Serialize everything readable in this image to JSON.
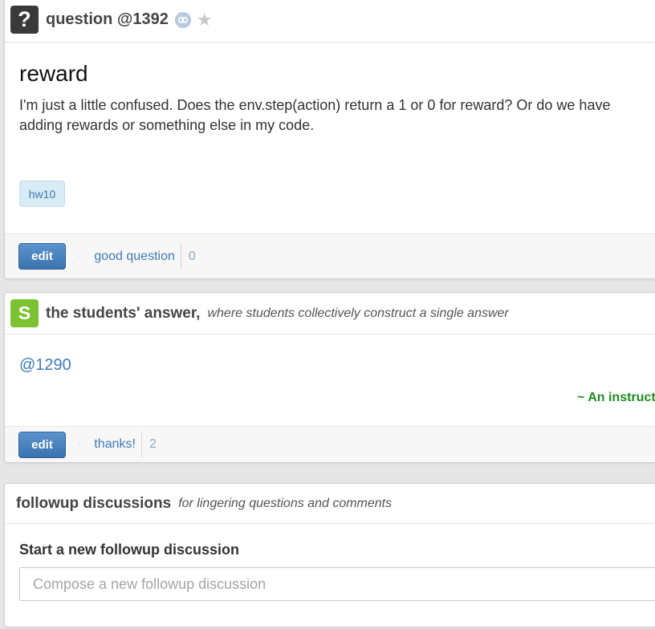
{
  "question": {
    "icon_glyph": "?",
    "header_title": "question @1392",
    "link_icon": "link-icon",
    "star_icon": "star-icon",
    "subject": "reward",
    "body": "I'm just a little confused. Does the env.step(action) return a 1 or 0 for reward? Or do we have\nadding rewards or something else in my code.",
    "tags": [
      "hw10"
    ],
    "footer": {
      "edit_label": "edit",
      "separator": "·",
      "good_question_label": "good question",
      "good_question_count": "0"
    }
  },
  "students_answer": {
    "icon_glyph": "S",
    "title": "the students' answer,",
    "subtitle": "where students collectively construct a single answer",
    "body_ref": "@1290",
    "attribution": "~ An instruct",
    "footer": {
      "edit_label": "edit",
      "separator": "·",
      "thanks_label": "thanks!",
      "thanks_count": "2"
    }
  },
  "followup": {
    "title": "followup discussions",
    "subtitle": "for lingering questions and comments",
    "start_label": "Start a new followup discussion",
    "input_placeholder": "Compose a new followup discussion"
  },
  "colors": {
    "accent_blue": "#3f7ab8",
    "edit_button": "#3a73ae",
    "students_green": "#7dc233",
    "attribution_green": "#1f8b1f",
    "tag_bg": "#d9ebf5"
  }
}
